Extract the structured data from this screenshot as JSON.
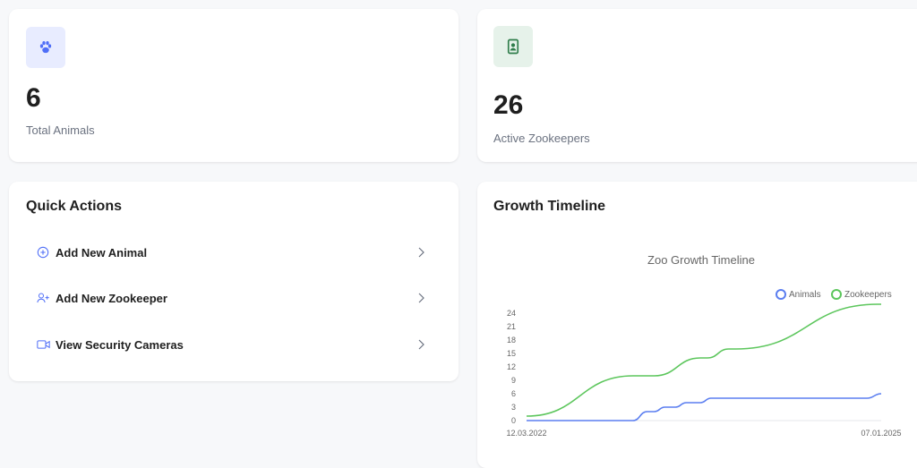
{
  "stats": [
    {
      "value": "6",
      "label": "Total Animals",
      "icon": "paw-icon",
      "color": "#4f6ef7",
      "bg": "#e8ecff"
    },
    {
      "value": "26",
      "label": "Active Zookeepers",
      "icon": "id-badge-icon",
      "color": "#2f7d4b",
      "bg": "#e6f2ea"
    }
  ],
  "quick_actions": {
    "title": "Quick Actions",
    "items": [
      {
        "label": "Add New Animal",
        "icon": "plus-circle-icon"
      },
      {
        "label": "Add New Zookeeper",
        "icon": "user-plus-icon"
      },
      {
        "label": "View Security Cameras",
        "icon": "video-icon"
      }
    ]
  },
  "growth": {
    "title": "Growth Timeline"
  },
  "chart_data": {
    "type": "line",
    "title": "Zoo Growth Timeline",
    "x_start_label": "12.03.2022",
    "x_end_label": "07.01.2025",
    "yticks": [
      0,
      3,
      6,
      9,
      12,
      15,
      18,
      21,
      24
    ],
    "ylim": [
      0,
      26
    ],
    "legend_position": "top-right",
    "series": [
      {
        "name": "Animals",
        "color": "#5b7ef0",
        "points": [
          [
            0,
            0
          ],
          [
            0.3,
            0
          ],
          [
            0.34,
            2
          ],
          [
            0.36,
            2
          ],
          [
            0.39,
            3
          ],
          [
            0.42,
            3
          ],
          [
            0.45,
            4
          ],
          [
            0.49,
            4
          ],
          [
            0.52,
            5
          ],
          [
            0.96,
            5
          ],
          [
            1,
            6
          ]
        ]
      },
      {
        "name": "Zookeepers",
        "color": "#5cc65c",
        "points": [
          [
            0,
            1
          ],
          [
            0.3,
            10
          ],
          [
            0.36,
            10
          ],
          [
            0.49,
            14
          ],
          [
            0.51,
            14
          ],
          [
            0.57,
            16
          ],
          [
            0.59,
            16
          ],
          [
            0.99,
            26
          ],
          [
            1,
            26
          ]
        ]
      }
    ]
  }
}
